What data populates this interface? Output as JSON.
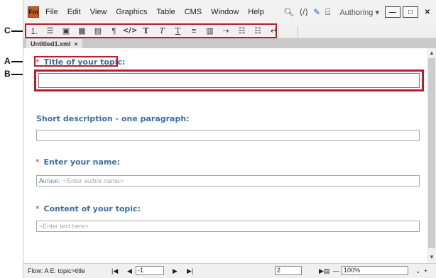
{
  "callouts": {
    "a": "A",
    "b": "B",
    "c": "C"
  },
  "app": {
    "logo": "Fm",
    "menu": [
      "File",
      "Edit",
      "View",
      "Graphics",
      "Table",
      "CMS",
      "Window",
      "Help"
    ],
    "workspace": "Authoring",
    "icons_right": [
      "search-icon",
      "xml-icon",
      "pen-icon",
      "frame-icon"
    ]
  },
  "toolbar": {
    "tools": [
      {
        "name": "numbered-list-icon",
        "glyph": "⋮≡"
      },
      {
        "name": "bulleted-list-icon",
        "glyph": "☰"
      },
      {
        "name": "image-icon",
        "glyph": "▣"
      },
      {
        "name": "table-icon",
        "glyph": "▦"
      },
      {
        "name": "note-icon",
        "glyph": "▤"
      },
      {
        "name": "paragraph-icon",
        "glyph": "¶"
      },
      {
        "name": "code-icon",
        "glyph": "</>"
      },
      {
        "name": "bold-icon",
        "glyph": "T"
      },
      {
        "name": "italic-icon",
        "glyph": "T"
      },
      {
        "name": "underline-icon",
        "glyph": "T"
      },
      {
        "name": "align-icon",
        "glyph": "≡"
      },
      {
        "name": "columns-icon",
        "glyph": "▥"
      },
      {
        "name": "link-icon",
        "glyph": "⇢"
      },
      {
        "name": "indent-list-icon",
        "glyph": "☷"
      },
      {
        "name": "outdent-list-icon",
        "glyph": "☷"
      },
      {
        "name": "return-icon",
        "glyph": "↵"
      }
    ]
  },
  "tab": {
    "label": "Untitled1.xml",
    "close": "×"
  },
  "document": {
    "required_marker": "*",
    "title_label": "Title of your topic:",
    "shortdesc_label": "Short description - one paragraph:",
    "name_label": "Enter your name:",
    "author_tag": "Author:",
    "author_placeholder": "<Enter author name>",
    "content_label": "Content of your topic:",
    "content_placeholder": "<Enter text here>"
  },
  "status": {
    "flow": "Flow: A  E: topic>title",
    "page_field": "-1",
    "page_number": "2",
    "zoom": "100%"
  }
}
